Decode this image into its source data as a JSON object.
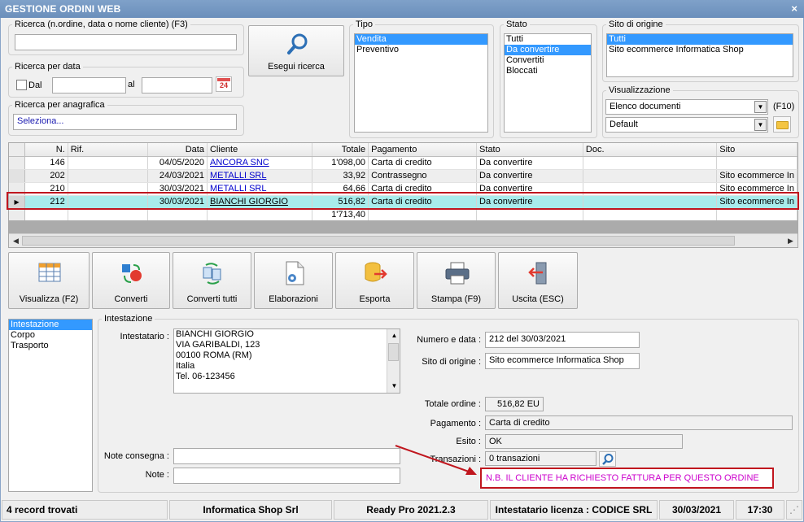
{
  "window": {
    "title": "GESTIONE ORDINI WEB",
    "close_glyph": "×"
  },
  "search": {
    "label": "Ricerca (n.ordine, data o nome cliente) (F3)",
    "value": "",
    "by_date_label": "Ricerca per data",
    "dal_label": "Dal",
    "al_label": "al",
    "date_from": "",
    "date_to": "",
    "calendar_glyph": "24",
    "anagrafica_label": "Ricerca per anagrafica",
    "anagrafica_value": "Seleziona...",
    "execute_label": "Esegui ricerca"
  },
  "tipo": {
    "label": "Tipo",
    "items": [
      "Vendita",
      "Preventivo"
    ],
    "selected": 0
  },
  "stato": {
    "label": "Stato",
    "items": [
      "Tutti",
      "Da convertire",
      "Convertiti",
      "Bloccati"
    ],
    "selected": 1
  },
  "sito": {
    "label": "Sito di origine",
    "items": [
      "Tutti",
      "Sito ecommerce Informatica Shop"
    ],
    "selected": 0
  },
  "visualizzazione": {
    "label": "Visualizzazione",
    "view_value": "Elenco documenti",
    "view_shortcut": "(F10)",
    "layout_value": "Default"
  },
  "grid": {
    "columns": [
      "N.",
      "Rif.",
      "Data",
      "Cliente",
      "Totale",
      "Pagamento",
      "Stato",
      "Doc.",
      "Sito"
    ],
    "rows": [
      {
        "n": "146",
        "rif": "",
        "data": "04/05/2020",
        "cliente": "ANCORA SNC",
        "totale": "1'098,00",
        "pagamento": "Carta di credito",
        "stato": "Da convertire",
        "doc": "",
        "sito": ""
      },
      {
        "n": "202",
        "rif": "",
        "data": "24/03/2021",
        "cliente": "METALLI SRL",
        "totale": "33,92",
        "pagamento": "Contrassegno",
        "stato": "Da convertire",
        "doc": "",
        "sito": "Sito ecommerce In"
      },
      {
        "n": "210",
        "rif": "",
        "data": "30/03/2021",
        "cliente": "METALLI SRL",
        "totale": "64,66",
        "pagamento": "Carta di credito",
        "stato": "Da convertire",
        "doc": "",
        "sito": "Sito ecommerce In"
      },
      {
        "n": "212",
        "rif": "",
        "data": "30/03/2021",
        "cliente": "BIANCHI GIORGIO",
        "totale": "516,82",
        "pagamento": "Carta di credito",
        "stato": "Da convertire",
        "doc": "",
        "sito": "Sito ecommerce In"
      }
    ],
    "selected_row": 3,
    "total": "1'713,40",
    "row_indicator_glyph": "▶"
  },
  "toolbar": {
    "buttons": [
      {
        "label": "Visualizza (F2)",
        "icon": "table-grid-icon"
      },
      {
        "label": "Converti",
        "icon": "convert-icon"
      },
      {
        "label": "Converti tutti",
        "icon": "convert-all-icon"
      },
      {
        "label": "Elaborazioni",
        "icon": "document-gear-icon"
      },
      {
        "label": "Esporta",
        "icon": "export-database-icon"
      },
      {
        "label": "Stampa (F9)",
        "icon": "printer-icon"
      },
      {
        "label": "Uscita (ESC)",
        "icon": "exit-door-icon"
      }
    ]
  },
  "sections": {
    "items": [
      "Intestazione",
      "Corpo",
      "Trasporto"
    ],
    "selected": 0
  },
  "detail": {
    "group_label": "Intestazione",
    "intestatario_label": "Intestatario :",
    "intestatario_lines": [
      "BIANCHI GIORGIO",
      "VIA GARIBALDI, 123",
      "00100 ROMA (RM)",
      "Italia",
      "Tel. 06-123456"
    ],
    "numero_data_label": "Numero e data :",
    "numero_data_value": "212 del 30/03/2021",
    "sito_label": "Sito di origine :",
    "sito_value": "Sito ecommerce Informatica Shop",
    "totale_label": "Totale ordine :",
    "totale_value": "516,82 EU",
    "pagamento_label": "Pagamento :",
    "pagamento_value": "Carta di credito",
    "esito_label": "Esito :",
    "esito_value": "OK",
    "transazioni_label": "Transazioni :",
    "transazioni_value": "0 transazioni",
    "note_consegna_label": "Note consegna :",
    "note_consegna_value": "",
    "note_label": "Note :",
    "note_value": "",
    "nb_message": "N.B. IL CLIENTE HA RICHIESTO FATTURA PER QUESTO ORDINE"
  },
  "status": {
    "records": "4 record trovati",
    "company": "Informatica Shop Srl",
    "version": "Ready Pro 2021.2.3",
    "license": "Intestatario licenza : CODICE SRL",
    "date": "30/03/2021",
    "time": "17:30"
  },
  "colors": {
    "accent_selection": "#3399ff",
    "selected_row": "#a8ecec",
    "highlight_border": "#c0161e",
    "nb_text": "#cc00cc",
    "title_bar": "#6f92bd"
  }
}
